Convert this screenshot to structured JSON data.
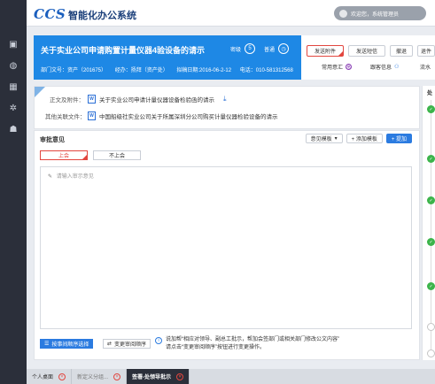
{
  "app": {
    "logo": "CCS",
    "name": "智能化办公系统"
  },
  "user": {
    "greeting": "欢迎您，系统管理员"
  },
  "nav": [
    {
      "name": "monitor-icon",
      "glyph": "▣"
    },
    {
      "name": "palette-icon",
      "glyph": "◍"
    },
    {
      "name": "org-icon",
      "glyph": "▦"
    },
    {
      "name": "gear-icon",
      "glyph": "✲"
    },
    {
      "name": "user-gear-icon",
      "glyph": "☗"
    }
  ],
  "doc": {
    "title": "关于实业公司申请购置计量仪器4验设备的请示",
    "tag_secret": "密级",
    "tag_secret_val": "5",
    "tag_normal": "普通",
    "meta_dept": "部门文号：资产（201675）",
    "meta_agent": "经办：扬拜（资产处）",
    "meta_date": "拟稿日期:2016-06-2-12",
    "meta_phone": "电话：010-581312568"
  },
  "actions": {
    "btn1": "发送附件",
    "btn2": "发送短信",
    "btn3": "撤退",
    "btn4": "退件",
    "link1": "常用意汇",
    "link1_badge": "常",
    "link2": "跟客信息",
    "link3": "流水"
  },
  "attachments": {
    "label_main": "正文及附件：",
    "file_main": "关于实业公司申请计量仪器设备检验函的请示",
    "label_other": "其他关联文件：",
    "file_other": "中国船级社实业公司关于所属深圳分公司购买计量仪器检验设备的请示",
    "file_badge": "W"
  },
  "approval": {
    "header": "审批意见",
    "tb_template": "意见模板",
    "tb_template_arrow": "▾",
    "tb_add": "+ 添加模板",
    "tb_add_blue": "+ 提加",
    "opt_agree": "上会",
    "opt_disagree": "不上会",
    "placeholder": "请输入审示意见",
    "btn_order": "按事间顺序选择",
    "btn_change": "变更审阅顺序",
    "hint_line1": "说加帮“相应对领导、副总工批示，帮加会签部门或相关部门修改公文内容”",
    "hint_line2": "请点击“变更审阅顺序”按钮进行变更操作。"
  },
  "timeline": {
    "title": "处"
  },
  "tabs": [
    {
      "label": "个人桌面",
      "state": "normal"
    },
    {
      "label": "新定义分组...",
      "state": "muted"
    },
    {
      "label": "签署-处领导批示",
      "state": "active"
    }
  ]
}
